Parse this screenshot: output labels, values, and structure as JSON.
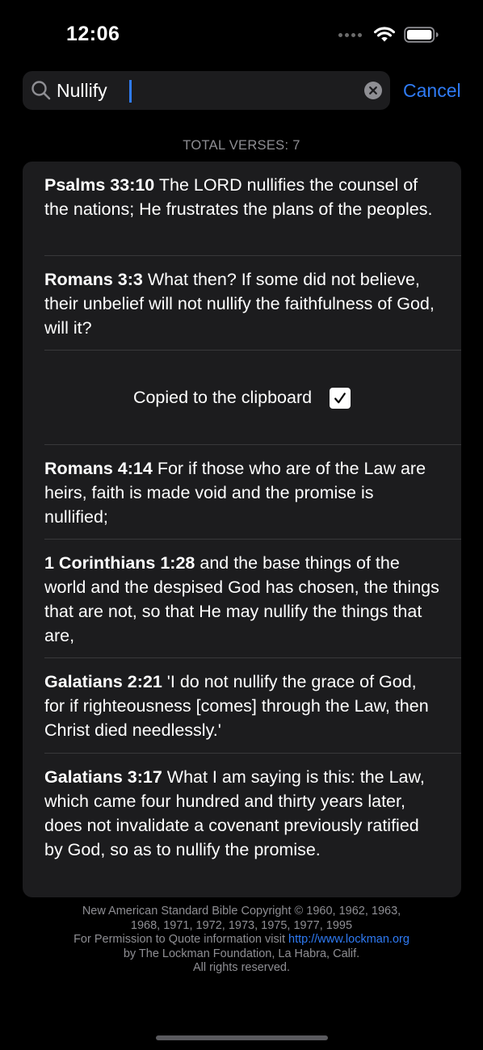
{
  "status_bar": {
    "time": "12:06"
  },
  "search": {
    "value": "Nullify",
    "cancel_label": "Cancel"
  },
  "results": {
    "total_label": "TOTAL VERSES: 7",
    "items": [
      {
        "ref": "Psalms 33:10",
        "text": " The LORD nullifies the counsel of the nations; He frustrates the plans of the peoples."
      },
      {
        "ref": "Romans 3:3",
        "text": " What then? If some did not believe, their unbelief will not nullify the faithfulness of God, will it?"
      },
      {
        "ref": "Romans 4:14",
        "text": " For if those who are of the Law are heirs, faith is made void and the promise is nullified;"
      },
      {
        "ref": "1 Corinthians 1:28",
        "text": " and the base things of the world and the despised God has chosen, the things that are not, so that He may nullify the things that are,"
      },
      {
        "ref": "Galatians 2:21",
        "text": " 'I do not nullify the grace of God, for if righteousness [comes] through the Law, then Christ died needlessly.'"
      },
      {
        "ref": "Galatians 3:17",
        "text": " What I am saying is this: the Law, which came four hundred and thirty years later, does not invalidate a covenant previously ratified by God, so as to nullify the promise."
      }
    ],
    "copied_label": "Copied to the clipboard"
  },
  "footer": {
    "line1": "New American Standard Bible Copyright © 1960, 1962, 1963,",
    "line2": "1968, 1971, 1972, 1973, 1975, 1977, 1995",
    "line3_prefix": "For Permission to Quote information visit ",
    "line3_link": "http://www.lockman.org",
    "line4": "by The Lockman Foundation, La Habra, Calif.",
    "line5": "All rights reserved."
  },
  "colors": {
    "background": "#000000",
    "card": "#1c1c1e",
    "accent": "#2f7bf5",
    "secondary_text": "#8e8e93",
    "divider": "#38383a"
  },
  "icons": {
    "search": "magnifying-glass-icon",
    "clear": "clear-circle-x-icon",
    "check": "checkmark-icon",
    "wifi": "wifi-icon",
    "battery": "battery-icon",
    "signal": "signal-dots-icon"
  }
}
